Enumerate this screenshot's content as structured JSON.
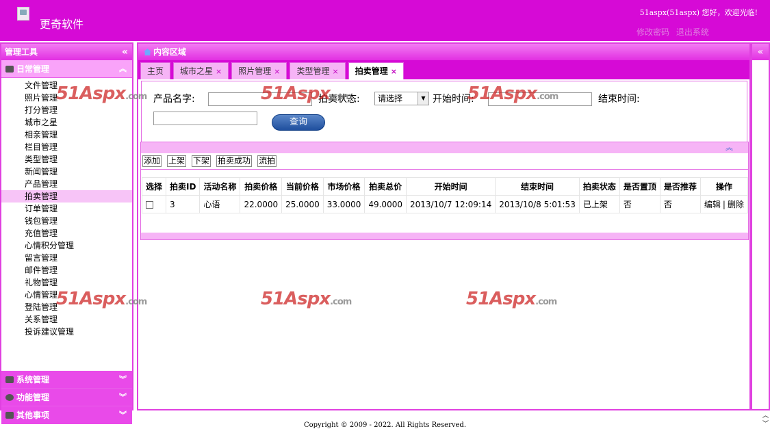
{
  "header": {
    "app_title": "更奇软件",
    "greeting": "51aspx(51aspx) 您好，欢迎光临!",
    "links": [
      "修改密码",
      "退出系统"
    ]
  },
  "left": {
    "title": "管理工具",
    "sections": [
      {
        "label": "日常管理",
        "icon": "users-icon",
        "expanded": true
      },
      {
        "label": "系统管理",
        "icon": "monitor-icon",
        "expanded": false
      },
      {
        "label": "功能管理",
        "icon": "gear-icon",
        "expanded": false
      },
      {
        "label": "其他事项",
        "icon": "misc-icon",
        "expanded": false
      }
    ],
    "menu": [
      "文件管理",
      "照片管理",
      "打分管理",
      "城市之星",
      "相亲管理",
      "栏目管理",
      "类型管理",
      "新闻管理",
      "产品管理",
      "拍卖管理",
      "订单管理",
      "钱包管理",
      "充值管理",
      "心情积分管理",
      "留言管理",
      "邮件管理",
      "礼物管理",
      "心情管理",
      "登陆管理",
      "关系管理",
      "投诉建议管理"
    ],
    "active_menu": "拍卖管理"
  },
  "content": {
    "title": "内容区域",
    "tabs": [
      {
        "label": "主页",
        "closable": false
      },
      {
        "label": "城市之星",
        "closable": true
      },
      {
        "label": "照片管理",
        "closable": true
      },
      {
        "label": "类型管理",
        "closable": true
      },
      {
        "label": "拍卖管理",
        "closable": true,
        "active": true
      }
    ],
    "search": {
      "product_name_label": "产品名字:",
      "status_label": "拍卖状态:",
      "status_value": "请选择",
      "start_time_label": "开始时间:",
      "end_time_label": "结束时间:",
      "query_label": "查询"
    },
    "toolbar": [
      "添加",
      "上架",
      "下架",
      "拍卖成功",
      "流拍"
    ],
    "table": {
      "columns": [
        "选择",
        "拍卖ID",
        "活动名称",
        "拍卖价格",
        "当前价格",
        "市场价格",
        "拍卖总价",
        "开始时间",
        "结束时间",
        "拍卖状态",
        "是否置顶",
        "是否推荐",
        "操作"
      ],
      "rows": [
        {
          "id": "3",
          "name": "心语",
          "auction_price": "22.0000",
          "current_price": "25.0000",
          "market_price": "33.0000",
          "total_price": "49.0000",
          "start": "2013/10/7 12:09:14",
          "end": "2013/10/8 5:01:53",
          "status": "已上架",
          "top": "否",
          "recommend": "否",
          "edit": "编辑",
          "sep": "|",
          "delete": "删除"
        }
      ]
    }
  },
  "watermark": {
    "main": "51Aspx",
    "suffix": ".com"
  },
  "footer": "Copyright © 2009 - 2022. All Rights Reserved."
}
